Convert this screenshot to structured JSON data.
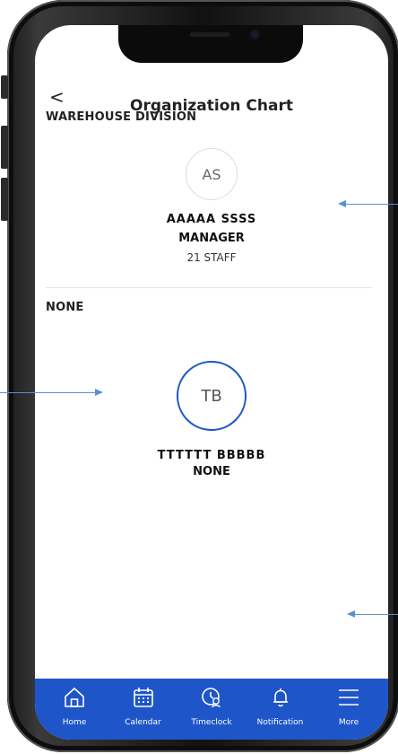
{
  "header": {
    "back_label": "<",
    "title": "Organization Chart"
  },
  "sections": [
    {
      "title": "WAREHOUSE DIVISION",
      "avatar_initials": "AS",
      "name": "AAAAA SSSS",
      "role": "MANAGER",
      "staff": "21 STAFF"
    },
    {
      "title": "NONE",
      "avatar_initials": "TB",
      "name": "TTTTTT BBBBB",
      "role": "NONE"
    }
  ],
  "tabbar": {
    "items": [
      {
        "label": "Home",
        "icon": "home-icon"
      },
      {
        "label": "Calendar",
        "icon": "calendar-icon"
      },
      {
        "label": "Timeclock",
        "icon": "timeclock-icon"
      },
      {
        "label": "Notification",
        "icon": "bell-icon"
      },
      {
        "label": "More",
        "icon": "menu-icon"
      }
    ]
  },
  "colors": {
    "accent": "#1e55c9",
    "avatar_ring": "#1e56c8",
    "annotation_arrow": "#5b8fd6"
  }
}
